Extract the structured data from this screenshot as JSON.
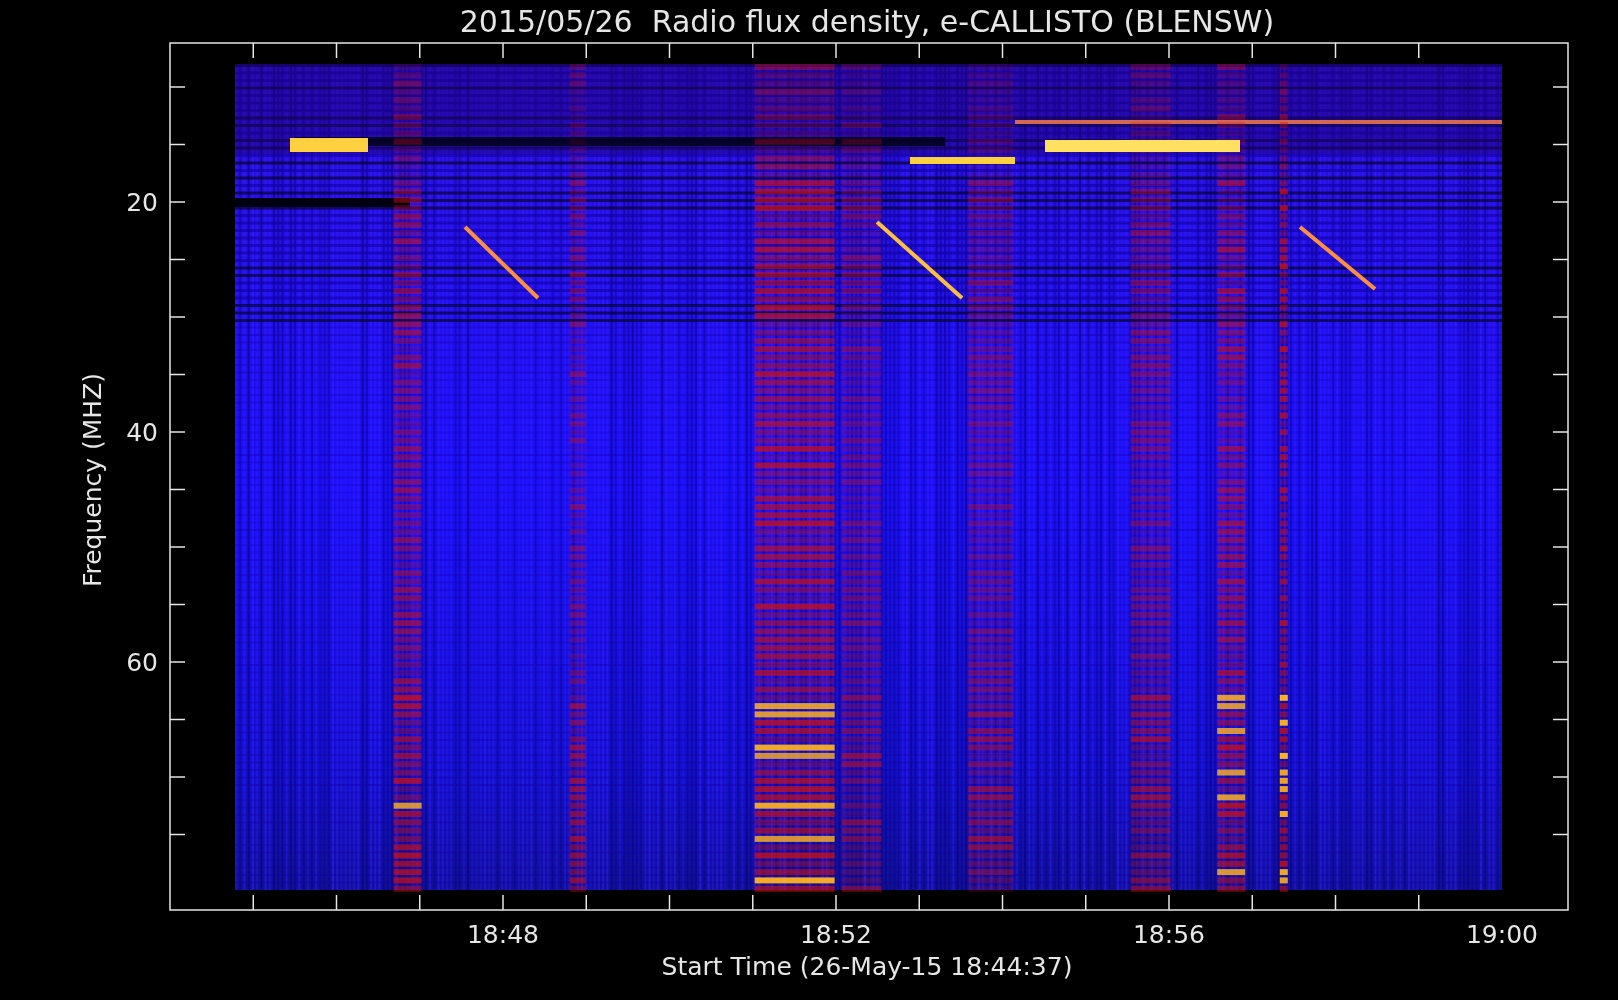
{
  "title": "2015/05/26  Radio flux density, e-CALLISTO (BLENSW)",
  "y_axis": {
    "label": "Frequency (MHZ)",
    "ticks": [
      "20",
      "40",
      "60"
    ]
  },
  "x_axis": {
    "label": "Start Time (26-May-15 18:44:37)",
    "ticks": [
      "18:48",
      "18:52",
      "18:56",
      "19:00"
    ]
  }
}
